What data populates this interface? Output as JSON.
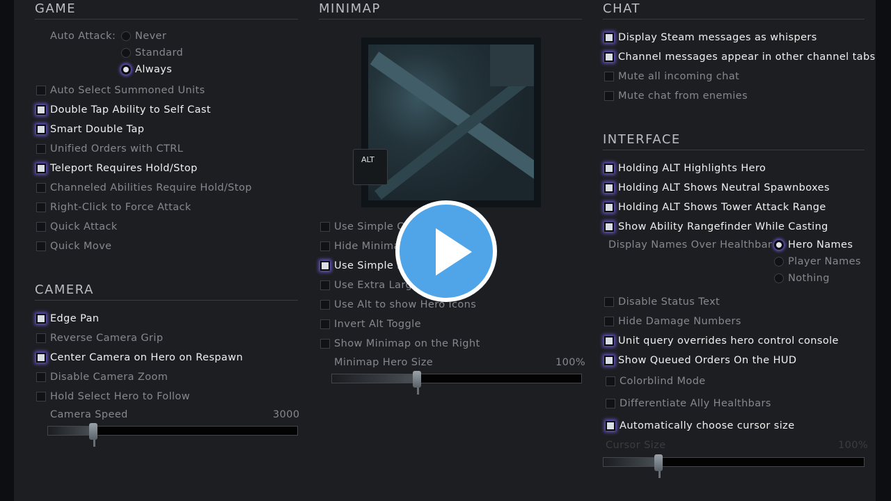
{
  "game": {
    "title": "GAME",
    "auto_attack_label": "Auto Attack:",
    "auto_attack_options": [
      {
        "label": "Never",
        "selected": false
      },
      {
        "label": "Standard",
        "selected": false
      },
      {
        "label": "Always",
        "selected": true
      }
    ],
    "items": [
      {
        "label": "Auto Select Summoned Units",
        "checked": false
      },
      {
        "label": "Double Tap Ability to Self Cast",
        "checked": true
      },
      {
        "label": "Smart Double Tap",
        "checked": true
      },
      {
        "label": "Unified Orders with CTRL",
        "checked": false
      },
      {
        "label": "Teleport Requires Hold/Stop",
        "checked": true
      },
      {
        "label": "Channeled Abilities Require Hold/Stop",
        "checked": false
      },
      {
        "label": "Right-Click to Force Attack",
        "checked": false
      },
      {
        "label": "Quick Attack",
        "checked": false
      },
      {
        "label": "Quick Move",
        "checked": false
      }
    ]
  },
  "camera": {
    "title": "CAMERA",
    "items": [
      {
        "label": "Edge Pan",
        "checked": true
      },
      {
        "label": "Reverse Camera Grip",
        "checked": false
      },
      {
        "label": "Center Camera on Hero on Respawn",
        "checked": true
      },
      {
        "label": "Disable Camera Zoom",
        "checked": false
      },
      {
        "label": "Hold Select Hero to Follow",
        "checked": false
      }
    ],
    "speed_label": "Camera Speed",
    "speed_value": "3000",
    "speed_fraction": 0.18
  },
  "minimap": {
    "title": "MINIMAP",
    "alt_label": "ALT",
    "items": [
      {
        "label": "Use Simple C",
        "checked": false
      },
      {
        "label": "Hide Minima",
        "checked": false
      },
      {
        "label": "Use Simple M                         d",
        "checked": true
      },
      {
        "label": "Use Extra Large",
        "checked": false
      },
      {
        "label": "Use Alt to show Hero icons",
        "checked": false
      },
      {
        "label": "Invert Alt Toggle",
        "checked": false
      },
      {
        "label": "Show Minimap on the Right",
        "checked": false
      }
    ],
    "hero_size_label": "Minimap Hero Size",
    "hero_size_value": "100%",
    "hero_size_fraction": 0.34
  },
  "chat": {
    "title": "CHAT",
    "items": [
      {
        "label": "Display Steam messages as whispers",
        "checked": true
      },
      {
        "label": "Channel messages appear in other channel tabs",
        "checked": true
      },
      {
        "label": "Mute all incoming chat",
        "checked": false
      },
      {
        "label": "Mute chat from enemies",
        "checked": false
      }
    ]
  },
  "interface": {
    "title": "INTERFACE",
    "items_a": [
      {
        "label": "Holding ALT Highlights Hero",
        "checked": true
      },
      {
        "label": "Holding ALT Shows Neutral Spawnboxes",
        "checked": true
      },
      {
        "label": "Holding ALT Shows Tower Attack Range",
        "checked": true
      },
      {
        "label": "Show Ability Rangefinder While Casting",
        "checked": true
      }
    ],
    "names_label": "Display Names Over Healthbar",
    "names_options": [
      {
        "label": "Hero Names",
        "selected": true
      },
      {
        "label": "Player Names",
        "selected": false
      },
      {
        "label": "Nothing",
        "selected": false
      }
    ],
    "items_b": [
      {
        "label": "Disable Status Text",
        "checked": false
      },
      {
        "label": "Hide Damage Numbers",
        "checked": false
      },
      {
        "label": "Unit query overrides hero control console",
        "checked": true
      },
      {
        "label": "Show Queued Orders On the HUD",
        "checked": true
      }
    ],
    "items_c": [
      {
        "label": "Colorblind Mode",
        "checked": false
      },
      {
        "label": "Differentiate Ally Healthbars",
        "checked": false
      },
      {
        "label": "Automatically choose cursor size",
        "checked": true
      }
    ],
    "cursor_label": "Cursor Size",
    "cursor_value": "100%",
    "cursor_fraction": 0.21
  },
  "video_overlay": {
    "icon": "play-icon",
    "color": "#4fa5e8"
  }
}
